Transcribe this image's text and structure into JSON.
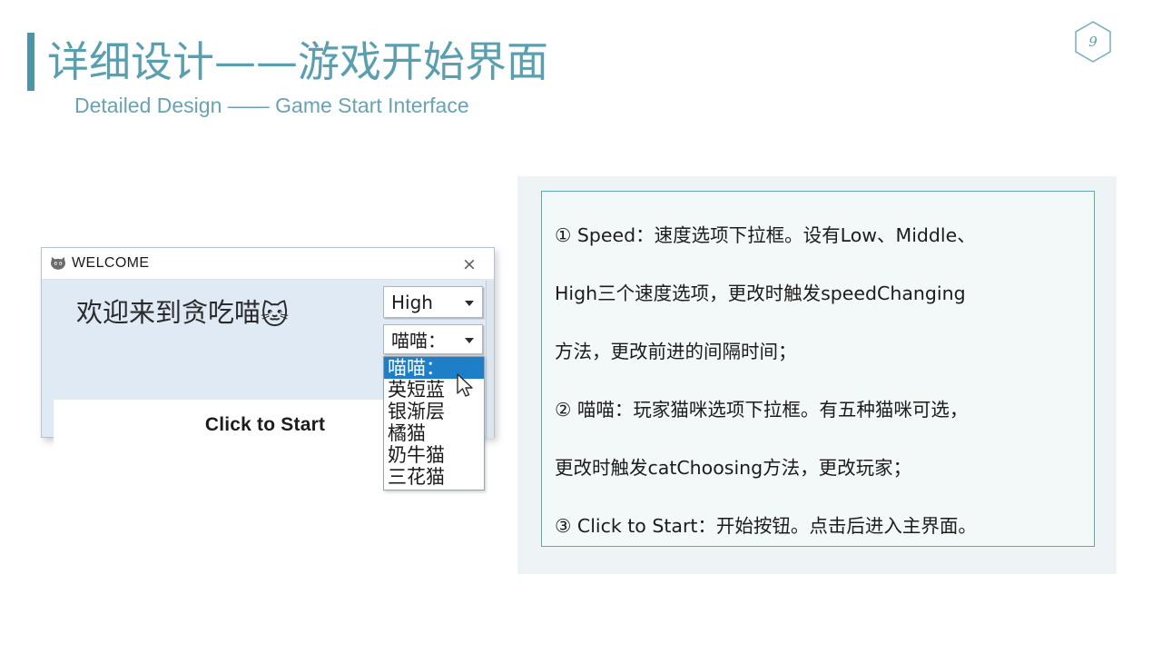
{
  "slide": {
    "title": "详细设计——游戏开始界面",
    "subtitle": "Detailed Design —— Game Start Interface",
    "page_number": "9",
    "accent_color": "#4e94a8",
    "title_color": "#5a9fb0",
    "subtitle_color": "#69a2b2"
  },
  "dialog": {
    "title": "WELCOME",
    "title_icon": "cat-face-icon",
    "close_icon": "×",
    "welcome_message": "欢迎来到贪吃喵",
    "welcome_emoji": "🐱",
    "start_button_label": "Click to Start",
    "body_color": "#dfeaf5",
    "titlebar_color": "#ffffff"
  },
  "speed_combobox": {
    "label": "Speed",
    "value": "High",
    "options": [
      "Low",
      "Middle",
      "High"
    ]
  },
  "cat_combobox": {
    "label": "喵喵：",
    "value": "喵喵：",
    "options": [
      {
        "label": "喵喵：",
        "selected": true
      },
      {
        "label": "英短蓝",
        "selected": false
      },
      {
        "label": "银渐层",
        "selected": false
      },
      {
        "label": "橘猫",
        "selected": false
      },
      {
        "label": "奶牛猫",
        "selected": false
      },
      {
        "label": "三花猫",
        "selected": false
      }
    ]
  },
  "description": {
    "border_color": "#60a6b6",
    "panel_color": "#eef4f6",
    "lines": [
      "① Speed：速度选项下拉框。设有Low、Middle、",
      "High三个速度选项，更改时触发speedChanging",
      "方法，更改前进的间隔时间；",
      "② 喵喵：玩家猫咪选项下拉框。有五种猫咪可选，",
      "更改时触发catChoosing方法，更改玩家；",
      "③ Click to Start：开始按钮。点击后进入主界面。"
    ]
  }
}
